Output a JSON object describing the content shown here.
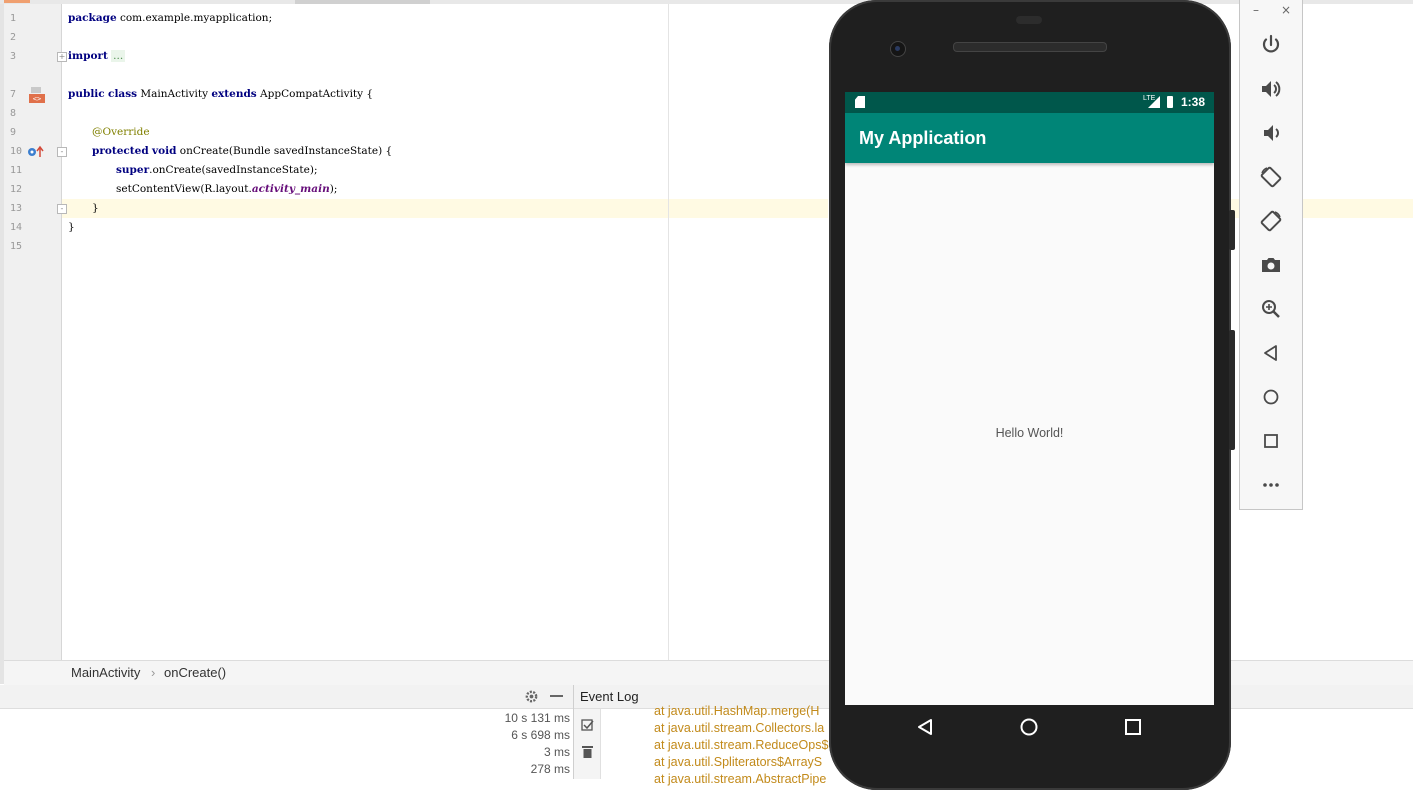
{
  "editor": {
    "line_numbers": [
      "1",
      "2",
      "3",
      "7",
      "8",
      "9",
      "10",
      "11",
      "12",
      "13",
      "14",
      "15"
    ],
    "lines": {
      "l1": {
        "kw": "package",
        "rest": " com.example.myapplication;"
      },
      "l3": {
        "kw": "import",
        "dots": "..."
      },
      "l7": {
        "kw1": "public",
        "kw2": "class",
        "name": " MainActivity ",
        "kw3": "extends",
        "rest": " AppCompatActivity {"
      },
      "l9": {
        "annotation": "@Override"
      },
      "l10": {
        "kw1": "protected",
        "kw2": "void",
        "rest": " onCreate(Bundle savedInstanceState) {"
      },
      "l11": {
        "kw": "super",
        "rest": ".onCreate(savedInstanceState);"
      },
      "l12": {
        "pre": "setContentView(R.layout.",
        "field": "activity_main",
        "post": ");"
      },
      "l13": {
        "text": "}"
      },
      "l14": {
        "text": "}"
      }
    }
  },
  "breadcrumb": {
    "class": "MainActivity",
    "separator": "›",
    "method": "onCreate()"
  },
  "bottom_panel": {
    "timings": [
      "10 s 131 ms",
      "6 s 698 ms",
      "3 ms",
      "278 ms"
    ]
  },
  "event_log": {
    "title": "Event Log",
    "lines": [
      "at java.util.HashMap.merge(H",
      "at java.util.stream.Collectors.la",
      "at java.util.stream.ReduceOps$",
      "at java.util.Spliterators$ArrayS",
      "at java.util.stream.AbstractPipe"
    ]
  },
  "emulator": {
    "status_time": "1:38",
    "status_network": "LTE",
    "app_title": "My Application",
    "hello_text": "Hello World!",
    "colors": {
      "primary": "#008577",
      "primary_dark": "#00574b",
      "accent": "#D81B60"
    }
  },
  "emulator_toolbar": {
    "minimize": "–",
    "close": "×",
    "buttons": [
      "power-icon",
      "volume-up-icon",
      "volume-down-icon",
      "rotate-left-icon",
      "rotate-right-icon",
      "camera-icon",
      "zoom-icon",
      "back-icon",
      "home-icon",
      "overview-icon",
      "more-icon"
    ]
  }
}
